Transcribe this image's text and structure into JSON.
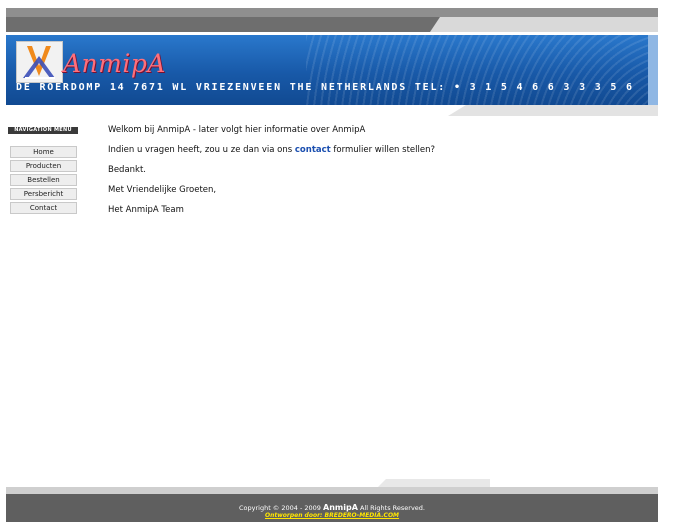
{
  "header": {
    "brand": "AnmipA",
    "address": "DE ROERDOMP  14  7671  WL  VRIEZENVEEN   THE NETHERLANDS   TEL: • 3 1 5 4 6 6 3 3 3 5 6"
  },
  "nav": {
    "heading": "NAVIGATION MENU",
    "items": [
      {
        "label": "Home"
      },
      {
        "label": "Producten"
      },
      {
        "label": "Bestellen"
      },
      {
        "label": "Persbericht"
      },
      {
        "label": "Contact"
      }
    ]
  },
  "content": {
    "p1": "Welkom bij AnmipA - later volgt hier informatie over AnmipA",
    "p2_before": "Indien u vragen heeft, zou u ze dan via ons ",
    "p2_link": "contact",
    "p2_after": " formulier willen stellen?",
    "p3": "Bedankt.",
    "p4": "Met Vriendelijke Groeten,",
    "p5": "Het AnmipA Team"
  },
  "footer": {
    "copyright_before": "Copyright © 2004 - 2009 ",
    "brand": "AnmipA",
    "copyright_after": " All Rights Reserved.",
    "credit_label": "Ontworpen door: ",
    "credit_site": "BREDERO-MEDIA.COM"
  },
  "colors": {
    "header_blue": "#1859a8",
    "brand_pink": "#ff6f7a",
    "link_blue": "#1b4fb0",
    "credit_yellow": "#ffe600"
  }
}
